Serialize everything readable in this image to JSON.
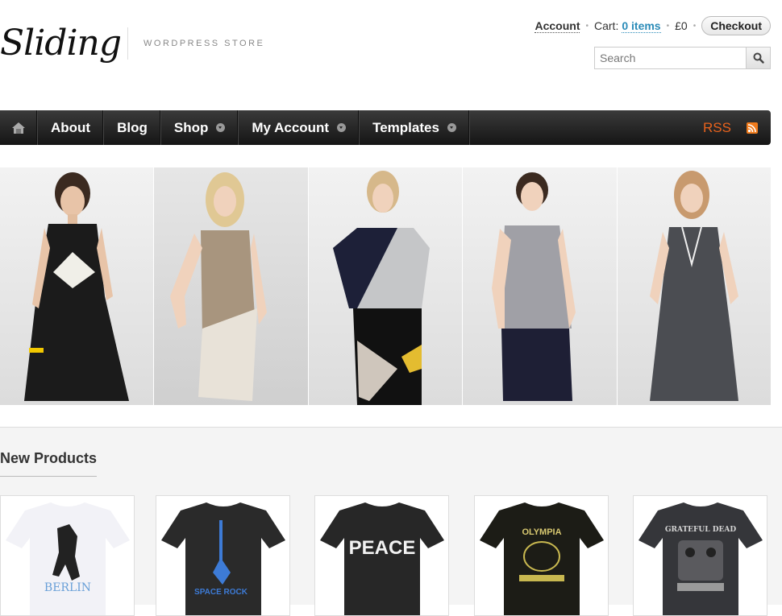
{
  "header": {
    "logo": "Sliding",
    "tagline": "WORDPRESS STORE",
    "account_label": "Account",
    "cart_label": "Cart:",
    "cart_items": "0 items",
    "cart_total": "£0",
    "checkout_label": "Checkout",
    "search_placeholder": "Search"
  },
  "nav": {
    "items": [
      {
        "label": "About"
      },
      {
        "label": "Blog"
      },
      {
        "label": "Shop"
      },
      {
        "label": "My Account"
      },
      {
        "label": "Templates"
      }
    ],
    "rss_label": "RSS"
  },
  "colors": {
    "nav_bg": "#1f1f1f",
    "rss": "#e8621c",
    "link": "#2a8bb8"
  },
  "products": {
    "heading": "New Products",
    "items": [
      {
        "print": "BERLIN"
      },
      {
        "print": "SPACE ROCK"
      },
      {
        "print": "PEACE"
      },
      {
        "print": "OLYMPIA"
      },
      {
        "print": "GRATEFUL DEAD"
      }
    ]
  }
}
